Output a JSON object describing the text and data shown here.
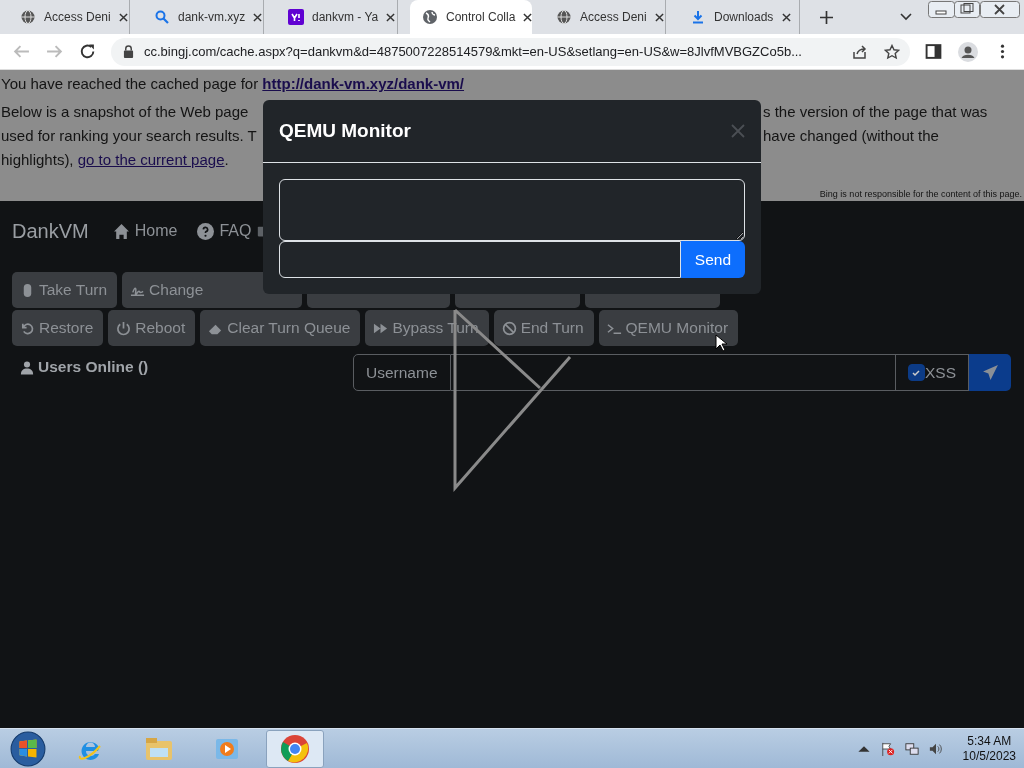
{
  "browser": {
    "tabs": [
      {
        "title": "Access Deni",
        "selected": false
      },
      {
        "title": "dank-vm.xyz",
        "selected": false
      },
      {
        "title": "dankvm - Ya",
        "selected": false
      },
      {
        "title": "Control Colla",
        "selected": true
      },
      {
        "title": "Access Deni",
        "selected": false
      },
      {
        "title": "Downloads",
        "selected": false
      }
    ],
    "address": "cc.bingj.com/cache.aspx?q=dankvm&d=4875007228514579&mkt=en-US&setlang=en-US&w=8JlvfMVBGZCo5b..."
  },
  "cache_notice": {
    "text": "You have reached the cached page for",
    "link": "http://dank-vm.xyz/dank-vm/",
    "lines": [
      {
        "left": "Below is a snapshot of the Web page",
        "right": "s the version of the page that was"
      },
      {
        "left": "used for ranking your search results. T",
        "right": "have changed (without the"
      }
    ],
    "last_line": "highlights),",
    "current_link": "go to the current page",
    "end": ".",
    "disclaimer": "Bing is not responsible for the content of this page."
  },
  "app": {
    "brand": "DankVM",
    "nav": [
      {
        "label": "Home"
      },
      {
        "label": "FAQ"
      }
    ],
    "button_rows": [
      [
        {
          "label": "Take Turn"
        },
        {
          "label": "Change"
        },
        {
          "kind": "covered"
        },
        {
          "kind": "covered"
        },
        {
          "kind": "covered"
        }
      ],
      [
        {
          "label": "Restore"
        },
        {
          "label": "Reboot"
        },
        {
          "label": "Clear Turn Queue"
        },
        {
          "label": "Bypass Turn"
        },
        {
          "label": "End Turn"
        },
        {
          "label": "QEMU Monitor"
        }
      ]
    ],
    "users_online": "Users Online ()",
    "chat": {
      "username_label": "Username",
      "xss_label": "XSS",
      "xss_checked": true
    }
  },
  "modal": {
    "title": "QEMU Monitor",
    "send": "Send"
  },
  "taskbar": {
    "items": [
      {
        "selected": false
      },
      {
        "selected": false
      },
      {
        "selected": false
      },
      {
        "selected": true
      }
    ],
    "time": "5:34 AM",
    "date": "10/5/2023"
  }
}
